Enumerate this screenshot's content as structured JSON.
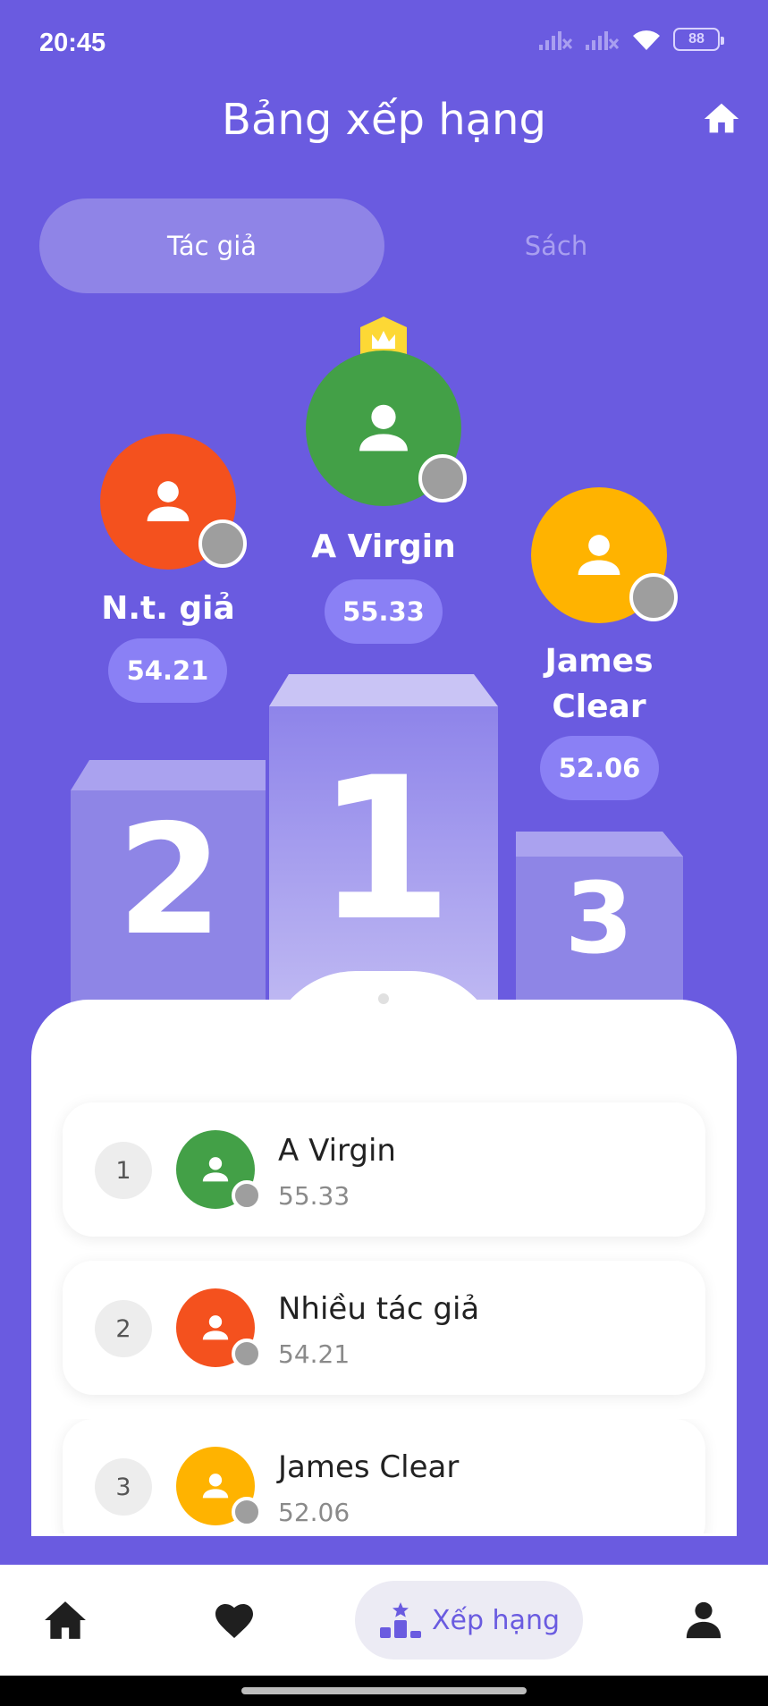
{
  "status_bar": {
    "time": "20:45",
    "battery": "88"
  },
  "header": {
    "title": "Bảng xếp hạng"
  },
  "tabs": [
    {
      "label": "Tác giả",
      "active": true
    },
    {
      "label": "Sách",
      "active": false
    }
  ],
  "podium": {
    "first": {
      "rank": "1",
      "name": "A Virgin",
      "score": "55.33",
      "color": "#43a047"
    },
    "second": {
      "rank": "2",
      "name": "N.t. giả",
      "score": "54.21",
      "color": "#f4511e"
    },
    "third": {
      "rank": "3",
      "name_line1": "James",
      "name_line2": "Clear",
      "score": "52.06",
      "color": "#ffb300"
    }
  },
  "ranking_list": [
    {
      "rank": "1",
      "name": "A Virgin",
      "score": "55.33",
      "color": "#43a047"
    },
    {
      "rank": "2",
      "name": "Nhiều tác giả",
      "score": "54.21",
      "color": "#f4511e"
    },
    {
      "rank": "3",
      "name": "James Clear",
      "score": "52.06",
      "color": "#ffb300"
    }
  ],
  "bottom_nav": {
    "items": [
      {
        "icon": "home-icon"
      },
      {
        "icon": "heart-icon"
      },
      {
        "icon": "podium-icon",
        "label": "Xếp hạng",
        "active": true
      },
      {
        "icon": "person-icon"
      }
    ]
  },
  "colors": {
    "primary": "#6a5be0",
    "pill": "#8a80f5",
    "crown": "#fdd835"
  }
}
